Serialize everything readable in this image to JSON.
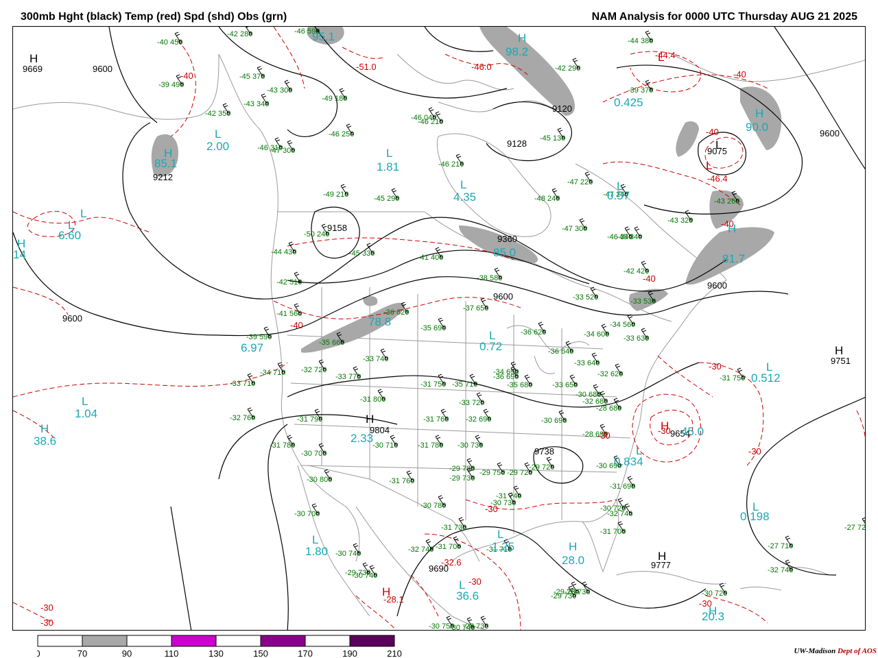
{
  "header": {
    "left_title": "300mb Hght (black) Temp (red) Spd (shd) Obs (grn)",
    "right_title": "NAM Analysis for 0000 UTC Thursday  AUG 21 2025"
  },
  "colors": {
    "height_contour": "#000000",
    "temp_contour": "#cc0000",
    "speed_shade_70_90": "#a8a8a8",
    "speed_shade_110_130": "#cc00cc",
    "speed_shade_150_170": "#8b008b",
    "speed_shade_190_210": "#5a005a",
    "obs": "#007700",
    "speed_center": "#1aa7b5",
    "geography": "#9a9a9a"
  },
  "legend": {
    "ticks": [
      "0",
      "70",
      "90",
      "110",
      "130",
      "150",
      "170",
      "190",
      "210"
    ],
    "fills": [
      "#ffffff",
      "#a8a8a8",
      "#ffffff",
      "#cc00cc",
      "#ffffff",
      "#8b008b",
      "#ffffff",
      "#5a005a"
    ]
  },
  "credit": {
    "org": "UW-Madison",
    "dept": "Dept of AOS"
  },
  "map": {
    "height_labels": [
      "9669",
      "9600",
      "9212",
      "9158",
      "9120",
      "9128",
      "9075",
      "9600",
      "9360",
      "9600",
      "9600",
      "9600",
      "9751",
      "9804",
      "9690",
      "9777",
      "9654",
      "9738"
    ],
    "temp_labels": [
      "-40",
      "-51.0",
      "-46.0",
      "-44.4",
      "-40",
      "-40",
      "-46.4",
      "-40",
      "-40",
      "-40",
      "-30",
      "-30",
      "-32.6",
      "-28.1",
      "-30",
      "-30",
      "-30",
      "-30",
      "-30",
      "-30",
      "-30"
    ],
    "speed_labels": [
      "85.1",
      "2.00",
      "95.1",
      "98.2",
      "90.0",
      "1.81",
      "4.35",
      "0.57",
      "6.60",
      "14",
      "85.0",
      "81.7",
      "78.8",
      "6.97",
      "0.72",
      "0.512",
      "2.33",
      "1.04",
      "38.6",
      "45.0",
      "0.834",
      "0.198",
      "1.80",
      "1.25",
      "28.0",
      "36.6",
      "20.3",
      "0.425"
    ],
    "high_marker": "H",
    "low_marker": "L",
    "station_obs": [
      "-40 450",
      "-42 280",
      "-46 590",
      "-43 300",
      "-45 370",
      "-39 490",
      "-42 350",
      "-43 340",
      "-49 180",
      "-46 250",
      "-46 210",
      "-46 040",
      "-45 130",
      "-42 290",
      "-44 380",
      "-39 370",
      "-46 310",
      "-47 300",
      "-46 210",
      "-47 220",
      "-47 240",
      "-43 260",
      "-43 320",
      "-46 340",
      "-49 210",
      "-45 290",
      "-48 240",
      "-47 300",
      "-45 340",
      "-50 240",
      "-45 330",
      "-44 430",
      "-41 400",
      "-38 580",
      "-42 420",
      "-33 530",
      "-42 510",
      "-41 560",
      "-33 520",
      "-36 620",
      "-37 650",
      "-34 560",
      "-39 590",
      "-35 660",
      "-35 690",
      "-36 620",
      "-34 600",
      "-33 630",
      "-33 740",
      "-32 720",
      "-34 710",
      "-33 710",
      "-33 770",
      "-34 690",
      "-36 640",
      "-36 690",
      "-33 650",
      "-33 640",
      "-32 620",
      "-31 750",
      "-31 750",
      "-35 710",
      "-35 680",
      "-30 680",
      "-32 680",
      "-28 680",
      "-31 800",
      "-33 720",
      "-32 760",
      "-31 790",
      "-31 760",
      "-32 690",
      "-30 690",
      "-28 690",
      "-31 780",
      "-30 700",
      "-30 800",
      "-30 710",
      "-30 730",
      "-31 780",
      "-29 780",
      "-29 730",
      "-29 750",
      "-29 720",
      "-29 720",
      "-30 690",
      "-31 690",
      "-30 700",
      "-30 780",
      "-31 760",
      "-31 740",
      "-30 730",
      "-30 720",
      "-31 700",
      "-27 710",
      "-27 720",
      "-32 740",
      "-32 740",
      "-31 730",
      "-31 700",
      "-31 710",
      "-32 740",
      "-30 740",
      "-30 740",
      "-29 730",
      "-29 760",
      "-29 730",
      "-28 730",
      "-30 720",
      "-30 750",
      "-30 740",
      "-28 730"
    ]
  }
}
